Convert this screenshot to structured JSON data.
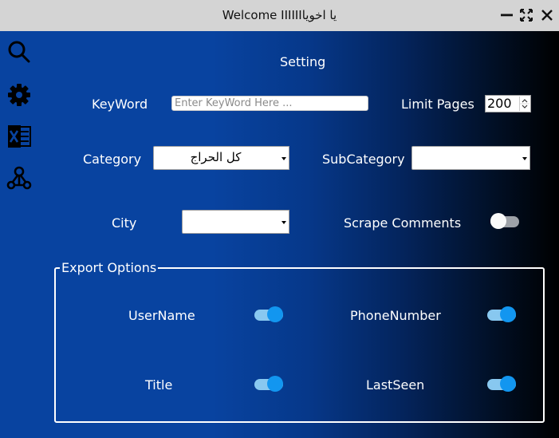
{
  "window": {
    "title": "Welcome IIIIIIيا اخويا",
    "controls": [
      "minimize-icon",
      "maximize-icon",
      "close-icon"
    ]
  },
  "sidebar": {
    "items": [
      {
        "icon": "search-icon"
      },
      {
        "icon": "gear-icon"
      },
      {
        "icon": "excel-icon"
      },
      {
        "icon": "network-icon"
      }
    ]
  },
  "main": {
    "heading": "Setting",
    "keyword": {
      "label": "KeyWord",
      "placeholder": "Enter KeyWord Here ..."
    },
    "limit_pages": {
      "label": "Limit Pages",
      "value": "200"
    },
    "category": {
      "label": "Category",
      "value": "كل الحراج"
    },
    "subcategory": {
      "label": "SubCategory",
      "value": ""
    },
    "city": {
      "label": "City",
      "value": ""
    },
    "scrape_comments": {
      "label": "Scrape Comments",
      "enabled": false
    }
  },
  "export_options": {
    "title": "Export Options",
    "options": [
      {
        "label": "UserName",
        "enabled": true
      },
      {
        "label": "PhoneNumber",
        "enabled": true
      },
      {
        "label": "Title",
        "enabled": true
      },
      {
        "label": "LastSeen",
        "enabled": true
      }
    ]
  },
  "colors": {
    "accent": "#1296f0",
    "background_start": "#0843a0",
    "background_end": "#000000",
    "titlebar": "#d4d4d4"
  }
}
